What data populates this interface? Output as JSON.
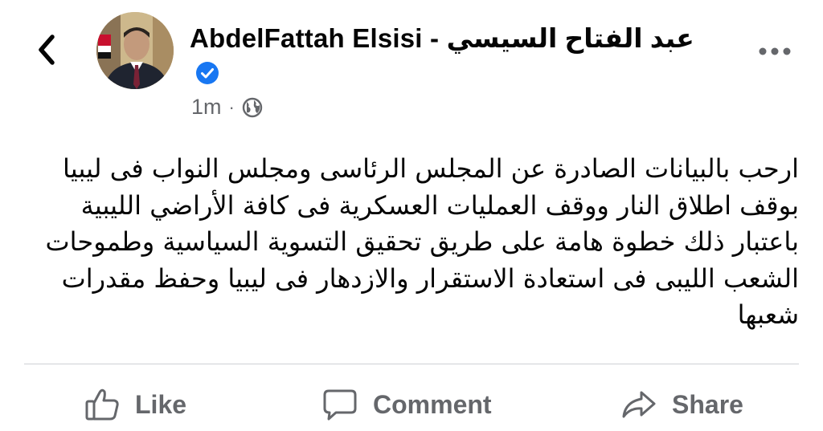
{
  "header": {
    "back_icon": "chevron-left-icon",
    "author_name": "AbdelFattah Elsisi - عبد  الفتاح  السيسي",
    "verified_icon": "verified-badge-icon",
    "timestamp": "1m",
    "separator": "·",
    "privacy_icon": "globe-icon",
    "more_icon": "more-horizontal-icon"
  },
  "post": {
    "lines": [
      "ارحب بالبيانات الصادرة عن  المجلس الرئاسى ومجلس النواب فى ليبيا",
      "بوقف اطلاق النار ووقف العمليات العسكرية فى كافة الأراضي الليبية",
      "باعتبار ذلك خطوة هامة على طريق تحقيق التسوية السياسية وطموحات",
      "الشعب الليبى فى استعادة الاستقرار والازدهار فى ليبيا وحفظ مقدرات",
      "شعبها"
    ]
  },
  "actions": {
    "like_label": "Like",
    "like_icon": "thumbs-up-icon",
    "comment_label": "Comment",
    "comment_icon": "speech-bubble-icon",
    "share_label": "Share",
    "share_icon": "share-arrow-icon"
  },
  "colors": {
    "text_primary": "#050505",
    "text_secondary": "#65676b",
    "verified_blue": "#1877f2",
    "divider": "#ced0d4"
  }
}
